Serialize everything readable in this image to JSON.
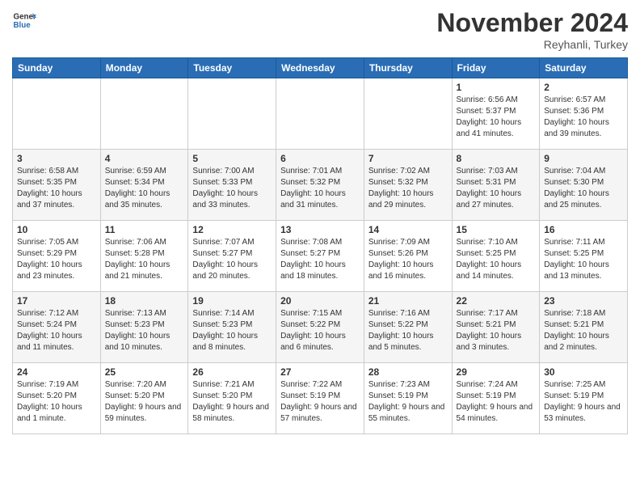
{
  "logo": {
    "general": "General",
    "blue": "Blue"
  },
  "header": {
    "month": "November 2024",
    "location": "Reyhanli, Turkey"
  },
  "weekdays": [
    "Sunday",
    "Monday",
    "Tuesday",
    "Wednesday",
    "Thursday",
    "Friday",
    "Saturday"
  ],
  "weeks": [
    [
      {
        "day": "",
        "content": ""
      },
      {
        "day": "",
        "content": ""
      },
      {
        "day": "",
        "content": ""
      },
      {
        "day": "",
        "content": ""
      },
      {
        "day": "",
        "content": ""
      },
      {
        "day": "1",
        "content": "Sunrise: 6:56 AM\nSunset: 5:37 PM\nDaylight: 10 hours and 41 minutes."
      },
      {
        "day": "2",
        "content": "Sunrise: 6:57 AM\nSunset: 5:36 PM\nDaylight: 10 hours and 39 minutes."
      }
    ],
    [
      {
        "day": "3",
        "content": "Sunrise: 6:58 AM\nSunset: 5:35 PM\nDaylight: 10 hours and 37 minutes."
      },
      {
        "day": "4",
        "content": "Sunrise: 6:59 AM\nSunset: 5:34 PM\nDaylight: 10 hours and 35 minutes."
      },
      {
        "day": "5",
        "content": "Sunrise: 7:00 AM\nSunset: 5:33 PM\nDaylight: 10 hours and 33 minutes."
      },
      {
        "day": "6",
        "content": "Sunrise: 7:01 AM\nSunset: 5:32 PM\nDaylight: 10 hours and 31 minutes."
      },
      {
        "day": "7",
        "content": "Sunrise: 7:02 AM\nSunset: 5:32 PM\nDaylight: 10 hours and 29 minutes."
      },
      {
        "day": "8",
        "content": "Sunrise: 7:03 AM\nSunset: 5:31 PM\nDaylight: 10 hours and 27 minutes."
      },
      {
        "day": "9",
        "content": "Sunrise: 7:04 AM\nSunset: 5:30 PM\nDaylight: 10 hours and 25 minutes."
      }
    ],
    [
      {
        "day": "10",
        "content": "Sunrise: 7:05 AM\nSunset: 5:29 PM\nDaylight: 10 hours and 23 minutes."
      },
      {
        "day": "11",
        "content": "Sunrise: 7:06 AM\nSunset: 5:28 PM\nDaylight: 10 hours and 21 minutes."
      },
      {
        "day": "12",
        "content": "Sunrise: 7:07 AM\nSunset: 5:27 PM\nDaylight: 10 hours and 20 minutes."
      },
      {
        "day": "13",
        "content": "Sunrise: 7:08 AM\nSunset: 5:27 PM\nDaylight: 10 hours and 18 minutes."
      },
      {
        "day": "14",
        "content": "Sunrise: 7:09 AM\nSunset: 5:26 PM\nDaylight: 10 hours and 16 minutes."
      },
      {
        "day": "15",
        "content": "Sunrise: 7:10 AM\nSunset: 5:25 PM\nDaylight: 10 hours and 14 minutes."
      },
      {
        "day": "16",
        "content": "Sunrise: 7:11 AM\nSunset: 5:25 PM\nDaylight: 10 hours and 13 minutes."
      }
    ],
    [
      {
        "day": "17",
        "content": "Sunrise: 7:12 AM\nSunset: 5:24 PM\nDaylight: 10 hours and 11 minutes."
      },
      {
        "day": "18",
        "content": "Sunrise: 7:13 AM\nSunset: 5:23 PM\nDaylight: 10 hours and 10 minutes."
      },
      {
        "day": "19",
        "content": "Sunrise: 7:14 AM\nSunset: 5:23 PM\nDaylight: 10 hours and 8 minutes."
      },
      {
        "day": "20",
        "content": "Sunrise: 7:15 AM\nSunset: 5:22 PM\nDaylight: 10 hours and 6 minutes."
      },
      {
        "day": "21",
        "content": "Sunrise: 7:16 AM\nSunset: 5:22 PM\nDaylight: 10 hours and 5 minutes."
      },
      {
        "day": "22",
        "content": "Sunrise: 7:17 AM\nSunset: 5:21 PM\nDaylight: 10 hours and 3 minutes."
      },
      {
        "day": "23",
        "content": "Sunrise: 7:18 AM\nSunset: 5:21 PM\nDaylight: 10 hours and 2 minutes."
      }
    ],
    [
      {
        "day": "24",
        "content": "Sunrise: 7:19 AM\nSunset: 5:20 PM\nDaylight: 10 hours and 1 minute."
      },
      {
        "day": "25",
        "content": "Sunrise: 7:20 AM\nSunset: 5:20 PM\nDaylight: 9 hours and 59 minutes."
      },
      {
        "day": "26",
        "content": "Sunrise: 7:21 AM\nSunset: 5:20 PM\nDaylight: 9 hours and 58 minutes."
      },
      {
        "day": "27",
        "content": "Sunrise: 7:22 AM\nSunset: 5:19 PM\nDaylight: 9 hours and 57 minutes."
      },
      {
        "day": "28",
        "content": "Sunrise: 7:23 AM\nSunset: 5:19 PM\nDaylight: 9 hours and 55 minutes."
      },
      {
        "day": "29",
        "content": "Sunrise: 7:24 AM\nSunset: 5:19 PM\nDaylight: 9 hours and 54 minutes."
      },
      {
        "day": "30",
        "content": "Sunrise: 7:25 AM\nSunset: 5:19 PM\nDaylight: 9 hours and 53 minutes."
      }
    ]
  ]
}
